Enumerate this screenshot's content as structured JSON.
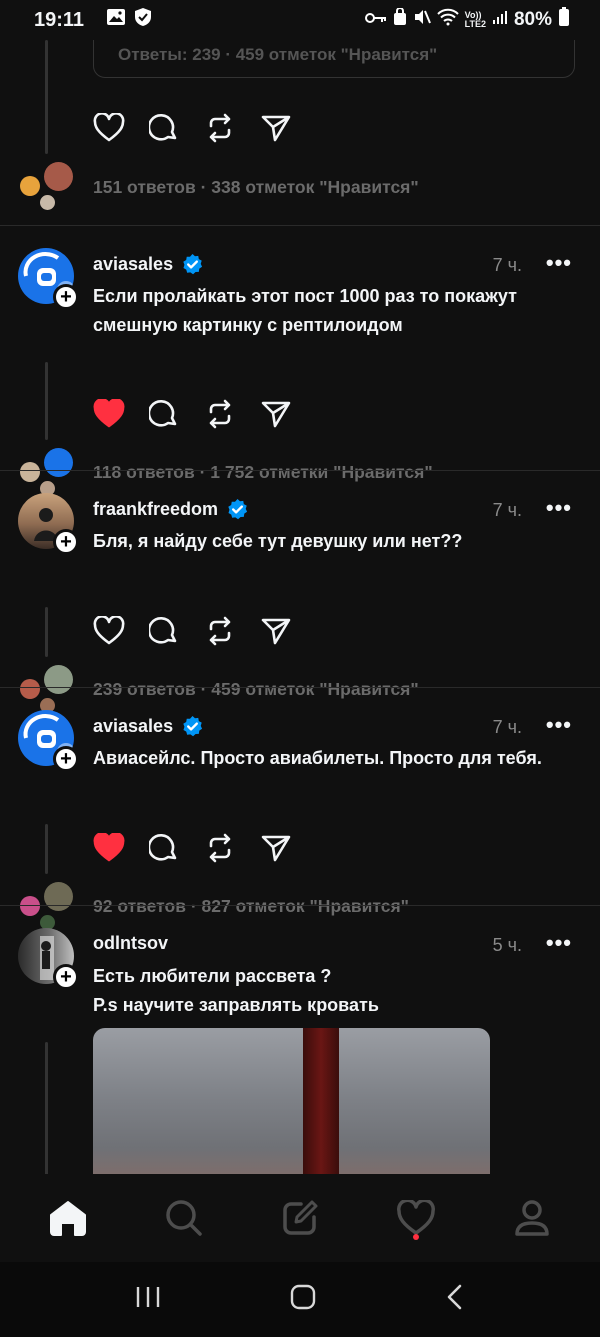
{
  "status_bar": {
    "time": "19:11",
    "battery": "80%",
    "network": "LTE2",
    "network_top": "Vo))"
  },
  "feed": {
    "quoted_stats": "Ответы: 239 · 459 отметок \"Нравится\"",
    "first_thread_stats": "151 ответов · 338 отметок \"Нравится\"",
    "posts": [
      {
        "username": "aviasales",
        "verified": true,
        "time": "7 ч.",
        "text": "Если пролайкать этот пост 1000 раз то покажут смешную картинку с рептилоидом",
        "liked": true,
        "stats": "118 ответов · 1 752 отметки \"Нравится\""
      },
      {
        "username": "fraankfreedom",
        "verified": true,
        "time": "7 ч.",
        "text": "Бля, я найду себе тут девушку или нет??",
        "liked": false,
        "stats": "239 ответов · 459 отметок \"Нравится\""
      },
      {
        "username": "aviasales",
        "verified": true,
        "time": "7 ч.",
        "text": "Авиасейлс. Просто авиабилеты. Просто для тебя.",
        "liked": true,
        "stats": "92 ответов · 827 отметок \"Нравится\""
      },
      {
        "username": "odlntsov",
        "verified": false,
        "time": "5 ч.",
        "text_line1": "Есть любители рассвета ?",
        "text_line2": "P.s научите заправлять кровать"
      }
    ],
    "more_label": "•••",
    "plus_label": "+"
  },
  "colors": {
    "background": "#101010",
    "like_red": "#ff3040",
    "verified_blue": "#0095f6",
    "aviasales_blue": "#1a73e8"
  },
  "bottom_nav": [
    "home-icon",
    "search-icon",
    "compose-icon",
    "activity-icon",
    "profile-icon"
  ]
}
